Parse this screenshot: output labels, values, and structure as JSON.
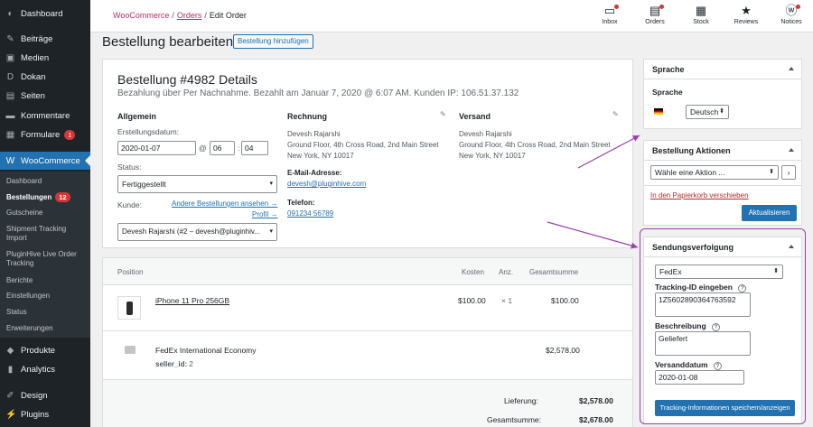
{
  "sidebar": {
    "items": [
      {
        "label": "Dashboard",
        "icon": "dashboard-icon",
        "glyph": "◐"
      },
      {
        "label": "Beiträge",
        "icon": "pin-icon",
        "glyph": "✎"
      },
      {
        "label": "Medien",
        "icon": "media-icon",
        "glyph": "▣"
      },
      {
        "label": "Dokan",
        "icon": "dokan-icon",
        "glyph": "D"
      },
      {
        "label": "Seiten",
        "icon": "pages-icon",
        "glyph": "▤"
      },
      {
        "label": "Kommentare",
        "icon": "comments-icon",
        "glyph": "▬"
      },
      {
        "label": "Formulare",
        "icon": "forms-icon",
        "glyph": "▦",
        "badge": "1"
      },
      {
        "label": "WooCommerce",
        "icon": "woocommerce-icon",
        "glyph": "W"
      },
      {
        "label": "Produkte",
        "icon": "products-icon",
        "glyph": "◆"
      },
      {
        "label": "Analytics",
        "icon": "analytics-icon",
        "glyph": "▮"
      },
      {
        "label": "Design",
        "icon": "design-icon",
        "glyph": "✐"
      },
      {
        "label": "Plugins",
        "icon": "plugins-icon",
        "glyph": "⚡"
      }
    ],
    "submenu": [
      {
        "label": "Dashboard"
      },
      {
        "label": "Bestellungen",
        "badge": "12"
      },
      {
        "label": "Gutscheine"
      },
      {
        "label": "Shipment Tracking Import"
      },
      {
        "label": "PluginHive Live Order Tracking"
      },
      {
        "label": "Berichte"
      },
      {
        "label": "Einstellungen"
      },
      {
        "label": "Status"
      },
      {
        "label": "Erweiterungen"
      }
    ]
  },
  "breadcrumb": {
    "root": "WooCommerce",
    "orders": "Orders",
    "current": "Edit Order",
    "sep": "/"
  },
  "toolbar": [
    {
      "label": "Inbox",
      "icon": "inbox-icon",
      "glyph": "▭"
    },
    {
      "label": "Orders",
      "icon": "orders-icon",
      "glyph": "▤"
    },
    {
      "label": "Stock",
      "icon": "stock-icon",
      "glyph": "▦"
    },
    {
      "label": "Reviews",
      "icon": "reviews-icon",
      "glyph": "★"
    },
    {
      "label": "Notices",
      "icon": "notices-icon",
      "glyph": "ⓦ"
    }
  ],
  "page": {
    "title": "Bestellung bearbeiten",
    "add_button": "Bestellung hinzufügen"
  },
  "order": {
    "heading": "Bestellung #4982 Details",
    "subheading": "Bezahlung über Per Nachnahme. Bezahlt am Januar 7, 2020 @ 6:07 AM. Kunden IP: 106.51.37.132",
    "general": {
      "title": "Allgemein",
      "date_label": "Erstellungsdatum:",
      "date": "2020-01-07",
      "at": "@",
      "hour": "06",
      "colon": ":",
      "minute": "04",
      "status_label": "Status:",
      "status": "Fertiggestellt",
      "customer_label": "Kunde:",
      "other_orders": "Andere Bestellungen ansehen →",
      "profile": "Profil →",
      "customer": "Devesh Rajarshi (#2 – devesh@pluginhiv..."
    },
    "billing": {
      "title": "Rechnung",
      "name": "Devesh Rajarshi",
      "address1": "Ground Floor, 4th Cross Road, 2nd Main Street",
      "address2": "New York, NY 10017",
      "email_label": "E-Mail-Adresse:",
      "email": "devesh@pluginhive.com",
      "phone_label": "Telefon:",
      "phone": "091234 56789"
    },
    "shipping": {
      "title": "Versand",
      "name": "Devesh Rajarshi",
      "address1": "Ground Floor, 4th Cross Road, 2nd Main Street",
      "address2": "New York, NY 10017"
    }
  },
  "items": {
    "headers": {
      "position": "Position",
      "cost": "Kosten",
      "qty": "Anz.",
      "total": "Gesamtsumme"
    },
    "product": {
      "name": "iPhone 11 Pro 256GB",
      "cost": "$100.00",
      "qty": "× 1",
      "total": "$100.00"
    },
    "shipping_line": {
      "name": "FedEx International Economy",
      "meta_key": "seller_id:",
      "meta_value": "2",
      "total": "$2,578.00"
    },
    "totals": {
      "shipping_label": "Lieferung:",
      "shipping": "$2,578.00",
      "grand_label": "Gesamtsumme:",
      "grand": "$2,678.00"
    }
  },
  "language": {
    "title": "Sprache",
    "label": "Sprache",
    "value": "Deutsch"
  },
  "actions": {
    "title": "Bestellung Aktionen",
    "select": "Wähle eine Aktion ...",
    "go": "›",
    "trash": "In den Papierkorb verschieben",
    "update": "Aktualisieren"
  },
  "tracking": {
    "title": "Sendungsverfolgung",
    "carrier": "FedEx",
    "id_label": "Tracking-ID eingeben",
    "id_value": "1Z5602890364763592",
    "desc_label": "Beschreibung",
    "desc_value": "Geliefert",
    "date_label": "Versanddatum",
    "date_value": "2020-01-08",
    "help": "?",
    "save": "Tracking-Informationen speichern/anzeigen"
  },
  "colors": {
    "accent": "#2271b1",
    "woo": "#b32d6f",
    "annotation": "#9b3fb1",
    "danger": "#d63638"
  }
}
